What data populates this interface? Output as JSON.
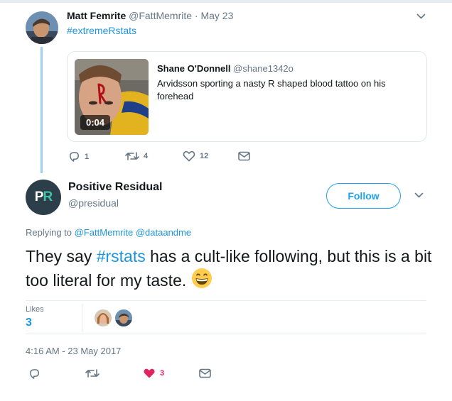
{
  "parent_tweet": {
    "author_name": "Matt Femrite",
    "author_handle": "@FattMemrite",
    "date": "May 23",
    "text": "#extremeRstats",
    "quoted": {
      "author_name": "Shane O'Donnell",
      "author_handle": "@shane1342o",
      "text": "Arvidsson sporting a nasty R shaped blood tattoo on his forehead",
      "video_duration": "0:04"
    },
    "counts": {
      "replies": "1",
      "retweets": "4",
      "likes": "12"
    }
  },
  "main_tweet": {
    "avatar_letters": {
      "first": "P",
      "second": "R"
    },
    "author_name": "Positive Residual",
    "author_handle": "@presidual",
    "follow_label": "Follow",
    "replying_prefix": "Replying to",
    "replying_to": [
      "@FattMemrite",
      "@dataandme"
    ],
    "text_before": "They say",
    "hashtag": "#rstats",
    "text_after": "has a cult-like following, but this is a bit too literal for my taste.",
    "likes_label": "Likes",
    "likes_count": "3",
    "timestamp": "4:16 AM - 23 May 2017",
    "action_like_count": "3"
  },
  "colors": {
    "link": "#1b95e0",
    "like_red": "#e0245e",
    "thread_line": "#9fd0f0",
    "muted": "#657786"
  },
  "icons": {
    "reply": "speech-bubble-icon",
    "retweet": "retweet-arrows-icon",
    "like": "heart-icon",
    "dm": "envelope-icon",
    "caret": "chevron-down-icon",
    "emoji": "grinning-face-emoji"
  }
}
